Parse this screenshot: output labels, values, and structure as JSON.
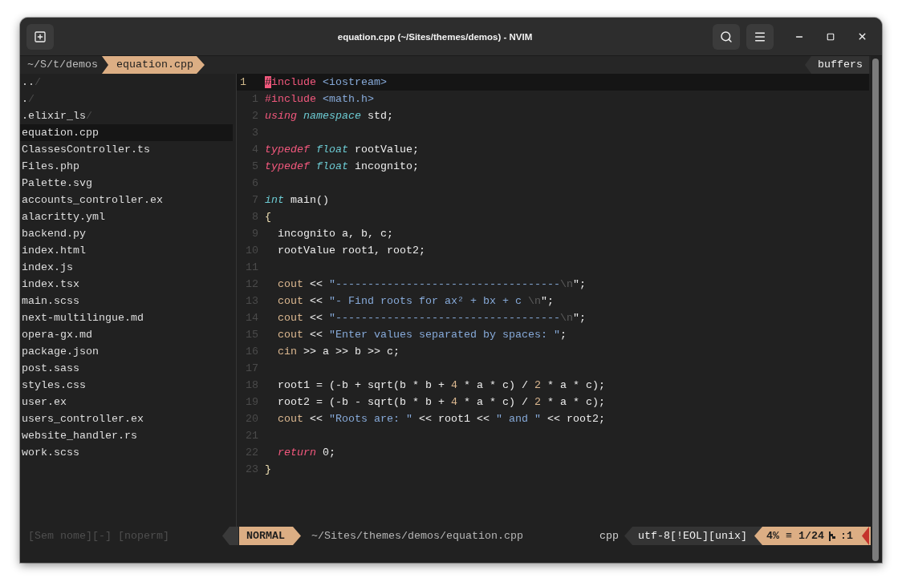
{
  "window": {
    "title": "equation.cpp (~/Sites/themes/demos) - NVIM"
  },
  "tabline": {
    "cwd": "~/S/t/demos",
    "tabs": [
      {
        "label": "equation.cpp",
        "selected": true
      }
    ],
    "buffers": "buffers"
  },
  "sidebar": {
    "items": [
      {
        "name": "..",
        "suffix": "/",
        "selected": false
      },
      {
        "name": ".",
        "suffix": "/",
        "selected": false
      },
      {
        "name": ".elixir_ls",
        "suffix": "/",
        "selected": false
      },
      {
        "name": "equation.cpp",
        "selected": true
      },
      {
        "name": "ClassesController.ts",
        "selected": false
      },
      {
        "name": "Files.php",
        "selected": false
      },
      {
        "name": "Palette.svg",
        "selected": false
      },
      {
        "name": "accounts_controller.ex",
        "selected": false
      },
      {
        "name": "alacritty.yml",
        "selected": false
      },
      {
        "name": "backend.py",
        "selected": false
      },
      {
        "name": "index.html",
        "selected": false
      },
      {
        "name": "index.js",
        "selected": false
      },
      {
        "name": "index.tsx",
        "selected": false
      },
      {
        "name": "main.scss",
        "selected": false
      },
      {
        "name": "next-multilingue.md",
        "selected": false
      },
      {
        "name": "opera-gx.md",
        "selected": false
      },
      {
        "name": "package.json",
        "selected": false
      },
      {
        "name": "post.sass",
        "selected": false
      },
      {
        "name": "styles.css",
        "selected": false
      },
      {
        "name": "user.ex",
        "selected": false
      },
      {
        "name": "users_controller.ex",
        "selected": false
      },
      {
        "name": "website_handler.rs",
        "selected": false
      },
      {
        "name": "work.scss",
        "selected": false
      }
    ]
  },
  "editor": {
    "lines": [
      {
        "number": "1",
        "current": true,
        "tokens": [
          {
            "kind": "cursor",
            "text": "#"
          },
          {
            "kind": "preproc",
            "text": "include"
          },
          {
            "kind": "header",
            "text": " <iostream>"
          }
        ]
      },
      {
        "number": "1",
        "current": false,
        "tokens": [
          {
            "kind": "preproc",
            "text": "#include"
          },
          {
            "kind": "header",
            "text": " <math.h>"
          }
        ]
      },
      {
        "number": "2",
        "current": false,
        "tokens": [
          {
            "kind": "keyword",
            "text": "using"
          },
          {
            "kind": "type",
            "text": " namespace"
          },
          {
            "kind": "plain",
            "text": " std;"
          }
        ]
      },
      {
        "number": "3",
        "current": false
      },
      {
        "number": "4",
        "current": false,
        "tokens": [
          {
            "kind": "keyword",
            "text": "typedef"
          },
          {
            "kind": "type",
            "text": " float"
          },
          {
            "kind": "plain",
            "text": " rootValue;"
          }
        ]
      },
      {
        "number": "5",
        "current": false,
        "tokens": [
          {
            "kind": "keyword",
            "text": "typedef"
          },
          {
            "kind": "type",
            "text": " float"
          },
          {
            "kind": "plain",
            "text": " incognito;"
          }
        ]
      },
      {
        "number": "6",
        "current": false
      },
      {
        "number": "7",
        "current": false,
        "tokens": [
          {
            "kind": "type",
            "text": "int"
          },
          {
            "kind": "plain",
            "text": " main()"
          }
        ]
      },
      {
        "number": "8",
        "current": false,
        "tokens": [
          {
            "kind": "brace",
            "text": "{"
          }
        ]
      },
      {
        "number": "9",
        "current": false,
        "tokens": [
          {
            "kind": "plain",
            "text": "  incognito a, b, c;"
          }
        ]
      },
      {
        "number": "10",
        "current": false,
        "tokens": [
          {
            "kind": "plain",
            "text": "  rootValue root1, root2;"
          }
        ]
      },
      {
        "number": "11",
        "current": false
      },
      {
        "number": "12",
        "current": false,
        "tokens": [
          {
            "kind": "builtin",
            "text": "  cout"
          },
          {
            "kind": "plain",
            "text": " << "
          },
          {
            "kind": "string",
            "text": "\"-----------------------------------"
          },
          {
            "kind": "escape",
            "text": "\\n"
          },
          {
            "kind": "plain",
            "text": "\";"
          }
        ]
      },
      {
        "number": "13",
        "current": false,
        "tokens": [
          {
            "kind": "builtin",
            "text": "  cout"
          },
          {
            "kind": "plain",
            "text": " << "
          },
          {
            "kind": "string",
            "text": "\"- Find roots for ax² + bx + c "
          },
          {
            "kind": "escape",
            "text": "\\n"
          },
          {
            "kind": "plain",
            "text": "\";"
          }
        ]
      },
      {
        "number": "14",
        "current": false,
        "tokens": [
          {
            "kind": "builtin",
            "text": "  cout"
          },
          {
            "kind": "plain",
            "text": " << "
          },
          {
            "kind": "string",
            "text": "\"-----------------------------------"
          },
          {
            "kind": "escape",
            "text": "\\n"
          },
          {
            "kind": "plain",
            "text": "\";"
          }
        ]
      },
      {
        "number": "15",
        "current": false,
        "tokens": [
          {
            "kind": "builtin",
            "text": "  cout"
          },
          {
            "kind": "plain",
            "text": " << "
          },
          {
            "kind": "string",
            "text": "\"Enter values separated by spaces: \""
          },
          {
            "kind": "plain",
            "text": ";"
          }
        ]
      },
      {
        "number": "16",
        "current": false,
        "tokens": [
          {
            "kind": "builtin",
            "text": "  cin"
          },
          {
            "kind": "plain",
            "text": " >> a >> b >> c;"
          }
        ]
      },
      {
        "number": "17",
        "current": false
      },
      {
        "number": "18",
        "current": false,
        "tokens": [
          {
            "kind": "plain",
            "text": "  root1 = (-b + sqrt(b * b + "
          },
          {
            "kind": "number",
            "text": "4"
          },
          {
            "kind": "plain",
            "text": " * a * c) / "
          },
          {
            "kind": "number",
            "text": "2"
          },
          {
            "kind": "plain",
            "text": " * a * c);"
          }
        ]
      },
      {
        "number": "19",
        "current": false,
        "tokens": [
          {
            "kind": "plain",
            "text": "  root2 = (-b - sqrt(b * b + "
          },
          {
            "kind": "number",
            "text": "4"
          },
          {
            "kind": "plain",
            "text": " * a * c) / "
          },
          {
            "kind": "number",
            "text": "2"
          },
          {
            "kind": "plain",
            "text": " * a * c);"
          }
        ]
      },
      {
        "number": "20",
        "current": false,
        "tokens": [
          {
            "kind": "builtin",
            "text": "  cout"
          },
          {
            "kind": "plain",
            "text": " << "
          },
          {
            "kind": "string",
            "text": "\"Roots are: \""
          },
          {
            "kind": "plain",
            "text": " << root1 << "
          },
          {
            "kind": "string",
            "text": "\" and \""
          },
          {
            "kind": "plain",
            "text": " << root2;"
          }
        ]
      },
      {
        "number": "21",
        "current": false
      },
      {
        "number": "22",
        "current": false,
        "tokens": [
          {
            "kind": "keyword",
            "text": "  return"
          },
          {
            "kind": "plain",
            "text": " 0;"
          }
        ]
      },
      {
        "number": "23",
        "current": false,
        "tokens": [
          {
            "kind": "brace",
            "text": "}"
          }
        ]
      }
    ]
  },
  "status_bar": {
    "inactive": "[Sem nome][-] [noperm]",
    "mode": {
      "label": "NORMAL",
      "kind": "normal"
    },
    "file": "~/Sites/themes/demos/equation.cpp",
    "filetype": "cpp",
    "encoding": "utf-8[!EOL][unix]",
    "position": "4% ≡ 1/24",
    "column": ":1"
  }
}
